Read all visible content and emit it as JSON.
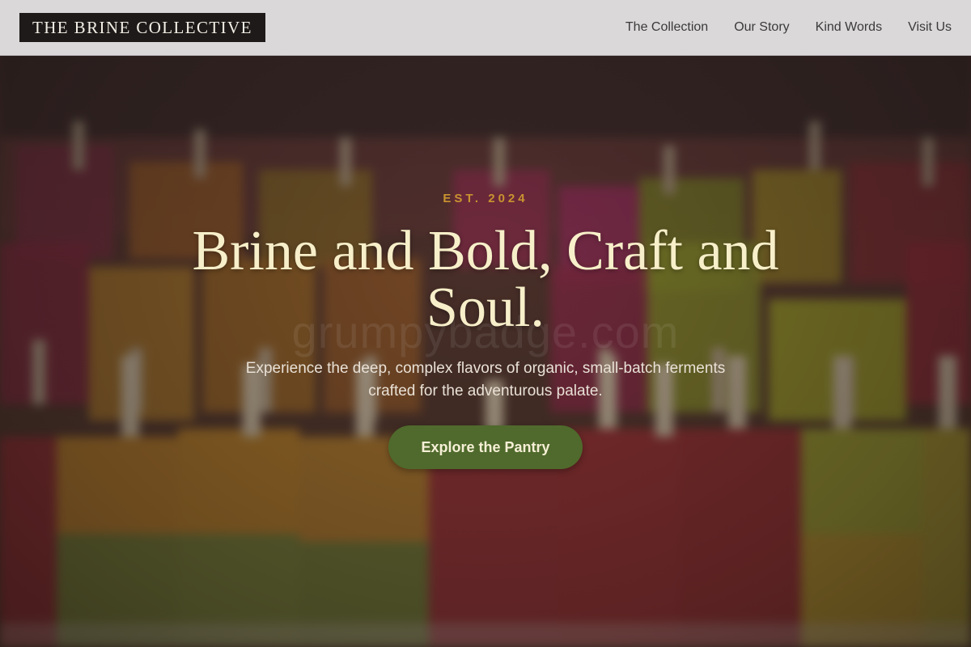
{
  "header": {
    "logo": "THE BRINE COLLECTIVE",
    "nav": [
      "The Collection",
      "Our Story",
      "Kind Words",
      "Visit Us"
    ]
  },
  "hero": {
    "eyebrow": "EST. 2024",
    "headline": "Brine and Bold, Craft and Soul.",
    "subhead": "Experience the deep, complex flavors of organic, small-batch ferments crafted for the adventurous palate.",
    "cta": "Explore the Pantry",
    "watermark": "grumpybadge.com"
  },
  "colors": {
    "accent_gold": "#c9932f",
    "headline_cream": "#f7efc9",
    "cta_green": "#4f6a2c",
    "logo_bg": "#1d1a19"
  }
}
